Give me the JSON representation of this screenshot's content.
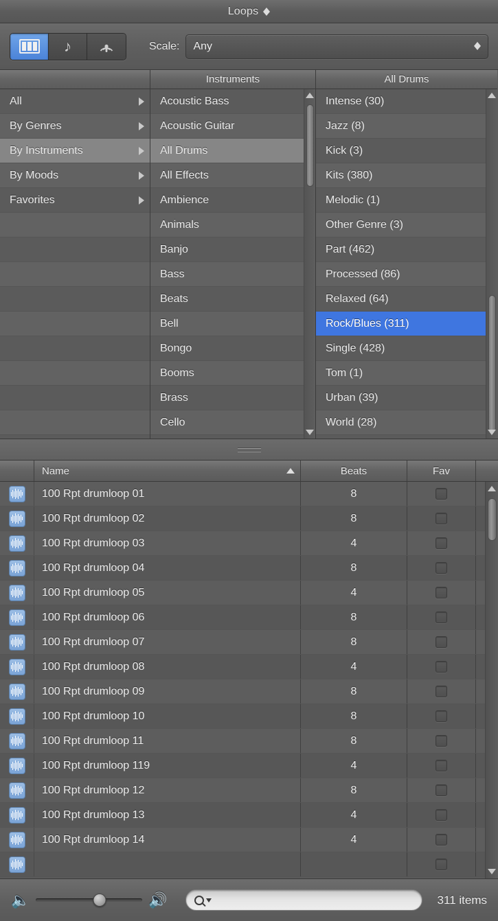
{
  "window": {
    "title": "Loops",
    "title_control_icon": "up-down-arrows-icon"
  },
  "toolbar": {
    "view_buttons": [
      {
        "name": "column-view",
        "icon": "columns-icon",
        "active": true
      },
      {
        "name": "music-note-view",
        "icon": "music-note-icon",
        "active": false
      },
      {
        "name": "podcast-view",
        "icon": "podcast-icon",
        "active": false
      }
    ],
    "scale_label": "Scale:",
    "scale_value": "Any",
    "scale_icon": "up-down-arrows-icon"
  },
  "browser": {
    "columns": [
      {
        "header": "",
        "items": [
          {
            "label": "All",
            "has_children": true,
            "selected": false
          },
          {
            "label": "By Genres",
            "has_children": true,
            "selected": false
          },
          {
            "label": "By Instruments",
            "has_children": true,
            "selected": true
          },
          {
            "label": "By Moods",
            "has_children": true,
            "selected": false
          },
          {
            "label": "Favorites",
            "has_children": true,
            "selected": false
          }
        ]
      },
      {
        "header": "Instruments",
        "items": [
          {
            "label": "Acoustic Bass",
            "has_children": true,
            "selected": false
          },
          {
            "label": "Acoustic Guitar",
            "has_children": true,
            "selected": false
          },
          {
            "label": "All Drums",
            "has_children": true,
            "selected": true
          },
          {
            "label": "All Effects",
            "has_children": true,
            "selected": false
          },
          {
            "label": "Ambience",
            "has_children": true,
            "selected": false
          },
          {
            "label": "Animals",
            "has_children": true,
            "selected": false
          },
          {
            "label": "Banjo",
            "has_children": true,
            "selected": false
          },
          {
            "label": "Bass",
            "has_children": true,
            "selected": false
          },
          {
            "label": "Beats",
            "has_children": true,
            "selected": false
          },
          {
            "label": "Bell",
            "has_children": true,
            "selected": false
          },
          {
            "label": "Bongo",
            "has_children": true,
            "selected": false
          },
          {
            "label": "Booms",
            "has_children": true,
            "selected": false
          },
          {
            "label": "Brass",
            "has_children": true,
            "selected": false
          },
          {
            "label": "Cello",
            "has_children": true,
            "selected": false
          }
        ]
      },
      {
        "header": "All Drums",
        "items": [
          {
            "label": "Intense (30)",
            "has_children": false,
            "selected": false
          },
          {
            "label": "Jazz (8)",
            "has_children": false,
            "selected": false
          },
          {
            "label": "Kick (3)",
            "has_children": false,
            "selected": false
          },
          {
            "label": "Kits (380)",
            "has_children": false,
            "selected": false
          },
          {
            "label": "Melodic (1)",
            "has_children": false,
            "selected": false
          },
          {
            "label": "Other Genre (3)",
            "has_children": false,
            "selected": false
          },
          {
            "label": "Part (462)",
            "has_children": false,
            "selected": false
          },
          {
            "label": "Processed (86)",
            "has_children": false,
            "selected": false
          },
          {
            "label": "Relaxed (64)",
            "has_children": false,
            "selected": false
          },
          {
            "label": "Rock/Blues (311)",
            "has_children": false,
            "selected": true
          },
          {
            "label": "Single (428)",
            "has_children": false,
            "selected": false
          },
          {
            "label": "Tom (1)",
            "has_children": false,
            "selected": false
          },
          {
            "label": "Urban (39)",
            "has_children": false,
            "selected": false
          },
          {
            "label": "World (28)",
            "has_children": false,
            "selected": false
          }
        ]
      }
    ]
  },
  "results_table": {
    "headers": {
      "icon": "",
      "name": "Name",
      "beats": "Beats",
      "fav": "Fav",
      "extra": ""
    },
    "sort_column": "Name",
    "sort_direction": "ascending",
    "rows": [
      {
        "icon": "audio-waveform-icon",
        "name": "100 Rpt drumloop 01",
        "beats": "8",
        "fav": false
      },
      {
        "icon": "audio-waveform-icon",
        "name": "100 Rpt drumloop 02",
        "beats": "8",
        "fav": false
      },
      {
        "icon": "audio-waveform-icon",
        "name": "100 Rpt drumloop 03",
        "beats": "4",
        "fav": false
      },
      {
        "icon": "audio-waveform-icon",
        "name": "100 Rpt drumloop 04",
        "beats": "8",
        "fav": false
      },
      {
        "icon": "audio-waveform-icon",
        "name": "100 Rpt drumloop 05",
        "beats": "4",
        "fav": false
      },
      {
        "icon": "audio-waveform-icon",
        "name": "100 Rpt drumloop 06",
        "beats": "8",
        "fav": false
      },
      {
        "icon": "audio-waveform-icon",
        "name": "100 Rpt drumloop 07",
        "beats": "8",
        "fav": false
      },
      {
        "icon": "audio-waveform-icon",
        "name": "100 Rpt drumloop 08",
        "beats": "4",
        "fav": false
      },
      {
        "icon": "audio-waveform-icon",
        "name": "100 Rpt drumloop 09",
        "beats": "8",
        "fav": false
      },
      {
        "icon": "audio-waveform-icon",
        "name": "100 Rpt drumloop 10",
        "beats": "8",
        "fav": false
      },
      {
        "icon": "audio-waveform-icon",
        "name": "100 Rpt drumloop 11",
        "beats": "8",
        "fav": false
      },
      {
        "icon": "audio-waveform-icon",
        "name": "100 Rpt drumloop 119",
        "beats": "4",
        "fav": false
      },
      {
        "icon": "audio-waveform-icon",
        "name": "100 Rpt drumloop 12",
        "beats": "8",
        "fav": false
      },
      {
        "icon": "audio-waveform-icon",
        "name": "100 Rpt drumloop 13",
        "beats": "4",
        "fav": false
      },
      {
        "icon": "audio-waveform-icon",
        "name": "100 Rpt drumloop 14",
        "beats": "4",
        "fav": false
      }
    ]
  },
  "bottom_bar": {
    "volume_low_icon": "speaker-low-icon",
    "volume_high_icon": "speaker-high-icon",
    "volume_percent": 60,
    "search_placeholder": "",
    "search_value": "",
    "search_icon": "magnifier-icon",
    "item_count": "311 items"
  },
  "colors": {
    "selection_blue": "#3f76e0",
    "selection_gray": "#868686",
    "accent_button": "#4b83d8",
    "panel_bg": "#5a5a5a"
  }
}
